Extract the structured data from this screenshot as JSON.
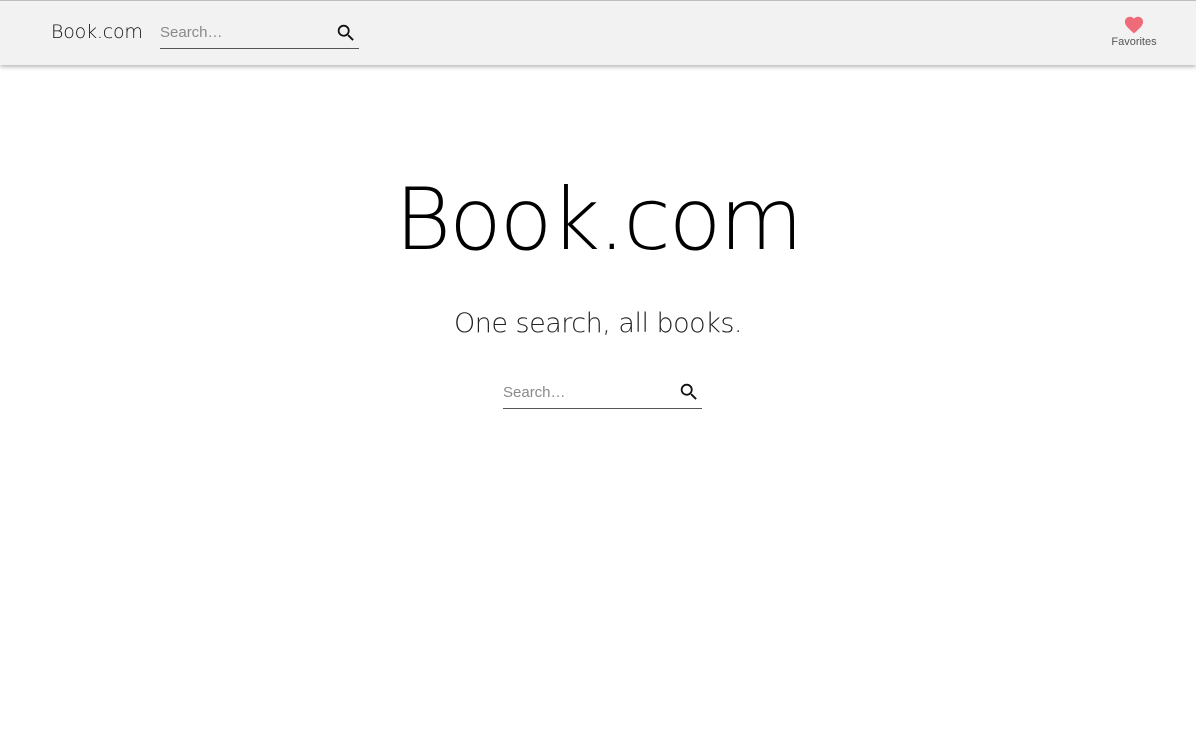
{
  "header": {
    "brand": "Book.com",
    "search": {
      "placeholder": "Search…",
      "icon": "search-icon"
    },
    "favorites": {
      "label": "Favorites",
      "icon": "heart-icon",
      "icon_color": "#f06b7a"
    }
  },
  "hero": {
    "title": "Book.com",
    "tagline": "One search, all books.",
    "search": {
      "placeholder": "Search…",
      "icon": "search-icon"
    }
  },
  "colors": {
    "header_background": "#f2f2f2",
    "page_background": "#ffffff",
    "text_primary": "#000000",
    "placeholder": "#8a8a8a"
  }
}
